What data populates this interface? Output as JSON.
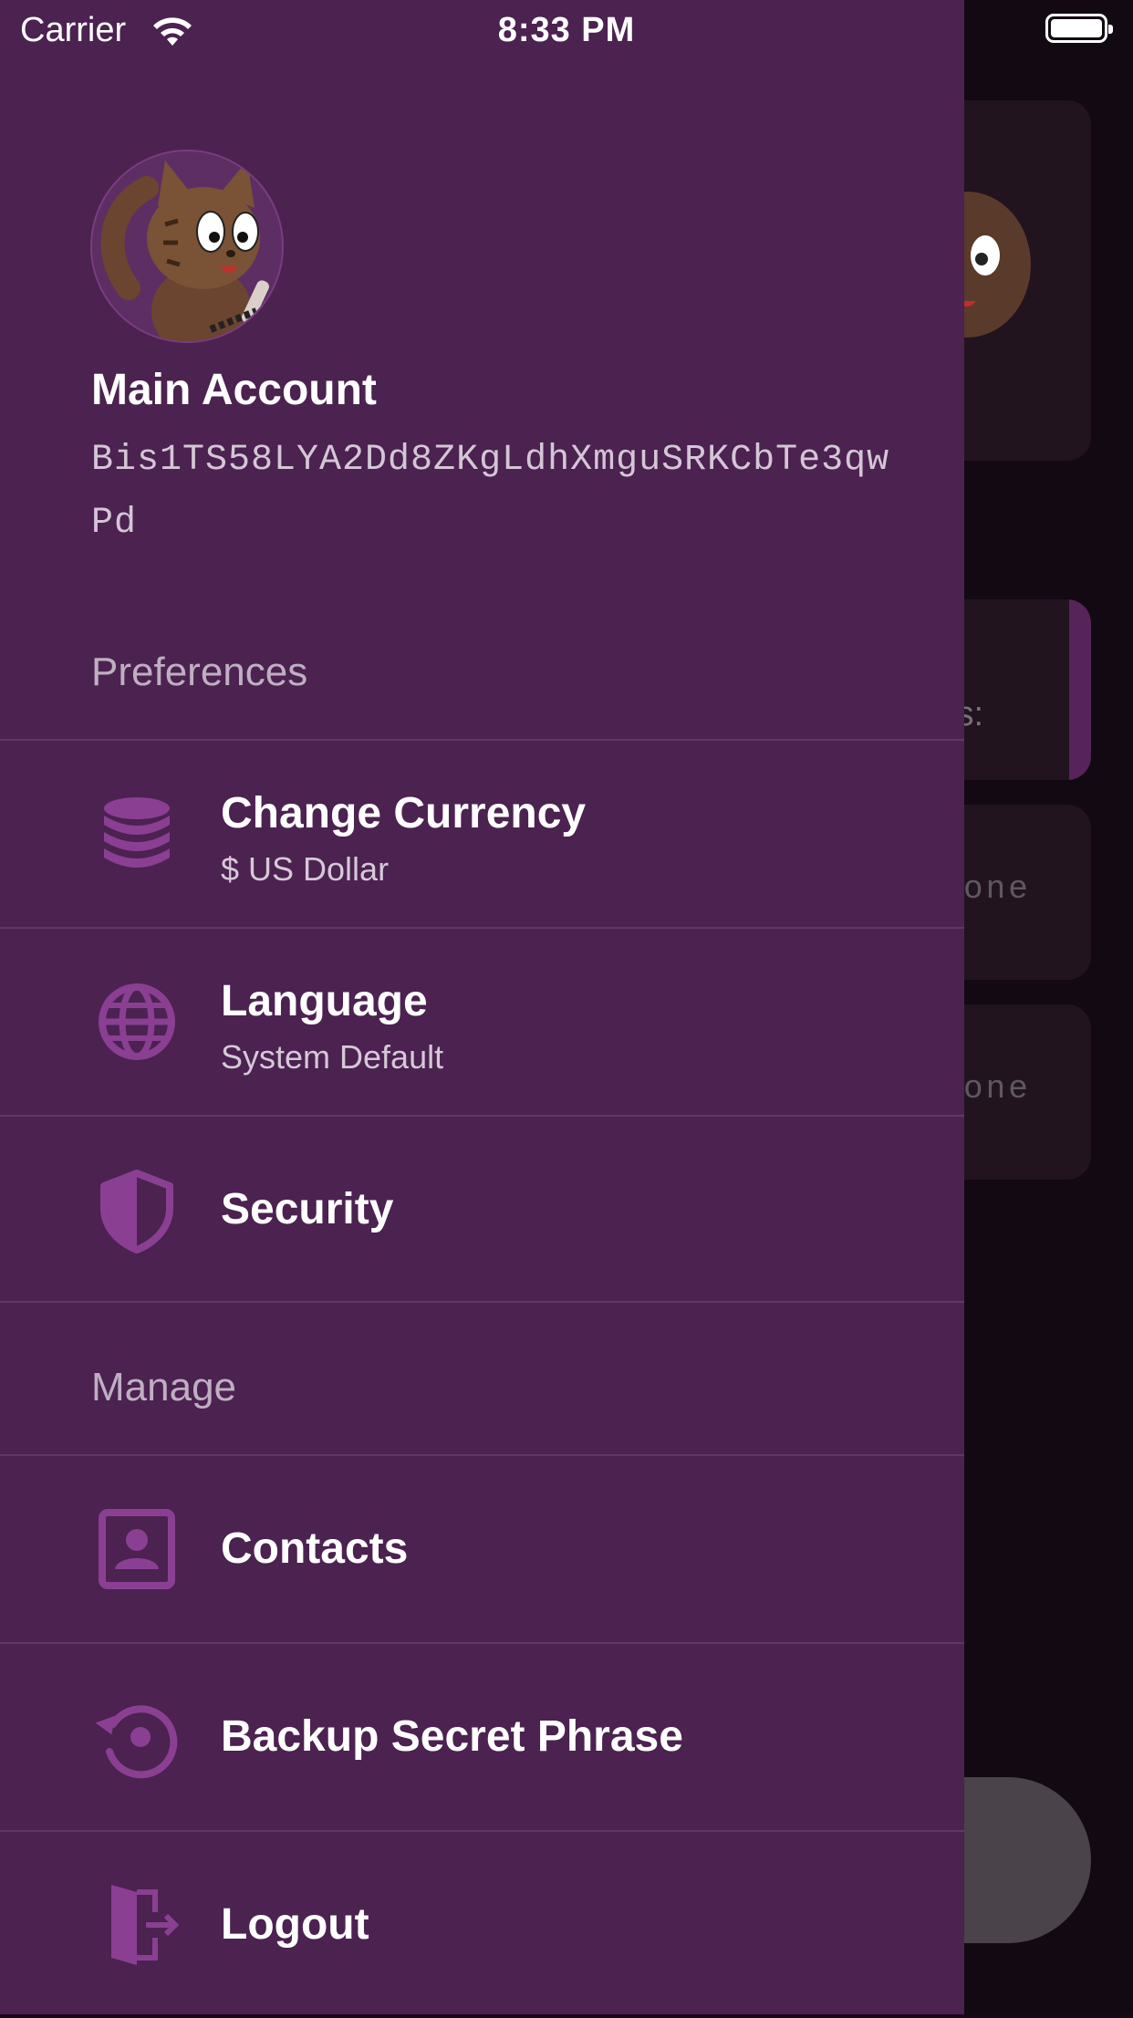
{
  "status_bar": {
    "carrier": "Carrier",
    "time": "8:33 PM"
  },
  "background": {
    "card_text": "is:",
    "row1_text": "one",
    "row2_text": "one"
  },
  "account": {
    "name": "Main Account",
    "address": "Bis1TS58LYA2Dd8ZKgLdhXmguSRKCbTe3qwPd"
  },
  "sections": {
    "preferences": "Preferences",
    "manage": "Manage"
  },
  "menu": {
    "currency": {
      "title": "Change Currency",
      "subtitle": "$ US Dollar",
      "icon": "database-icon"
    },
    "language": {
      "title": "Language",
      "subtitle": "System Default",
      "icon": "globe-icon"
    },
    "security": {
      "title": "Security",
      "icon": "shield-icon"
    },
    "contacts": {
      "title": "Contacts",
      "icon": "contact-card-icon"
    },
    "backup": {
      "title": "Backup Secret Phrase",
      "icon": "restore-icon"
    },
    "logout": {
      "title": "Logout",
      "icon": "logout-icon"
    }
  },
  "colors": {
    "drawer": "#4b2250",
    "icon_accent": "#8a3f93",
    "divider": "#603766"
  }
}
